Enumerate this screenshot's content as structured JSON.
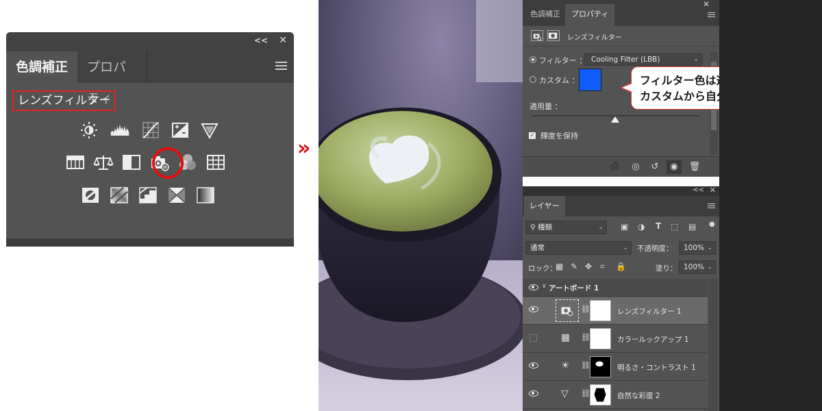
{
  "adjustments_panel": {
    "tab_active": "色調補正",
    "tab_inactive": "プロパティ",
    "selected_label": "レンズフィルター",
    "icons_row1": [
      "brightness-contrast-icon",
      "levels-icon",
      "curves-icon",
      "exposure-icon",
      "vibrance-icon"
    ],
    "icons_row2": [
      "hue-saturation-icon",
      "color-balance-icon",
      "black-white-icon",
      "photo-filter-icon",
      "channel-mixer-icon",
      "color-lookup-icon"
    ],
    "icons_row3": [
      "invert-icon",
      "posterize-icon",
      "threshold-icon",
      "selective-color-icon",
      "gradient-map-icon"
    ],
    "highlighted_icon": "photo-filter-icon",
    "highlight_color": "#e01010"
  },
  "arrow": "»",
  "properties_panel": {
    "tab_inactive": "色調補正",
    "tab_active": "プロパティ",
    "header_title": "レンズフィルター",
    "filter_label": "フィルター ：",
    "filter_value": "Cooling Filter (LBB)",
    "custom_label": "カスタム ：",
    "custom_color": "#0f5cff",
    "density_label": "適用量 ：",
    "preserve_label": "輝度を保持",
    "preserve_checked": true
  },
  "callout": {
    "line1": "フィルター色は選択肢 or",
    "line2": "カスタムから自分で設定も可能"
  },
  "layers_panel": {
    "tab": "レイヤー",
    "kind_value": "種類",
    "blend_mode": "通常",
    "opacity_label": "不透明度：",
    "opacity_value": "100%",
    "lock_label": "ロック：",
    "fill_label": "塗り：",
    "fill_value": "100%",
    "group_name": "アートボード 1",
    "layers": [
      {
        "name": "レンズフィルター 1",
        "visible": true,
        "selected": true,
        "icon": "photo-filter-icon"
      },
      {
        "name": "カラールックアップ 1",
        "visible": false,
        "selected": false,
        "icon": "color-lookup-icon"
      },
      {
        "name": "明るさ・コントラスト 1",
        "visible": true,
        "selected": false,
        "icon": "brightness-contrast-icon"
      },
      {
        "name": "自然な彩度 2",
        "visible": true,
        "selected": false,
        "icon": "vibrance-icon"
      }
    ]
  }
}
